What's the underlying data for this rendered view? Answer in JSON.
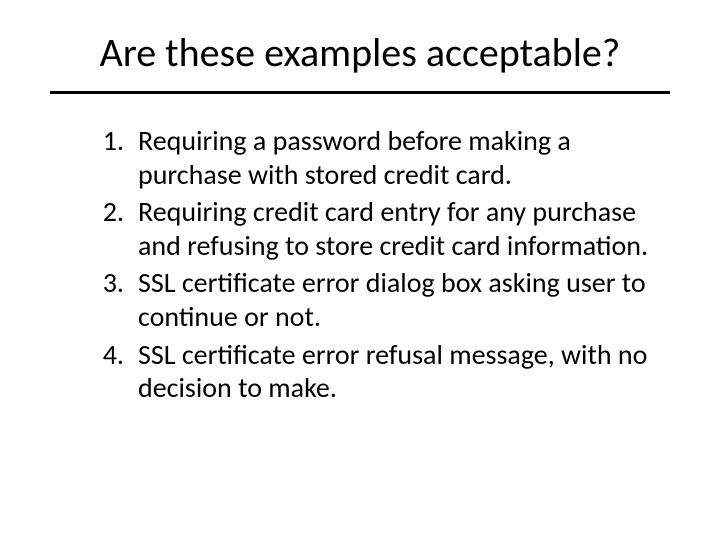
{
  "title": "Are these examples acceptable?",
  "items": [
    "Requiring a password before making a purchase with stored credit card.",
    "Requiring credit card entry for any purchase and refusing to store credit card information.",
    "SSL certificate error dialog box asking user to continue or not.",
    "SSL certificate error refusal message, with no decision to make."
  ]
}
